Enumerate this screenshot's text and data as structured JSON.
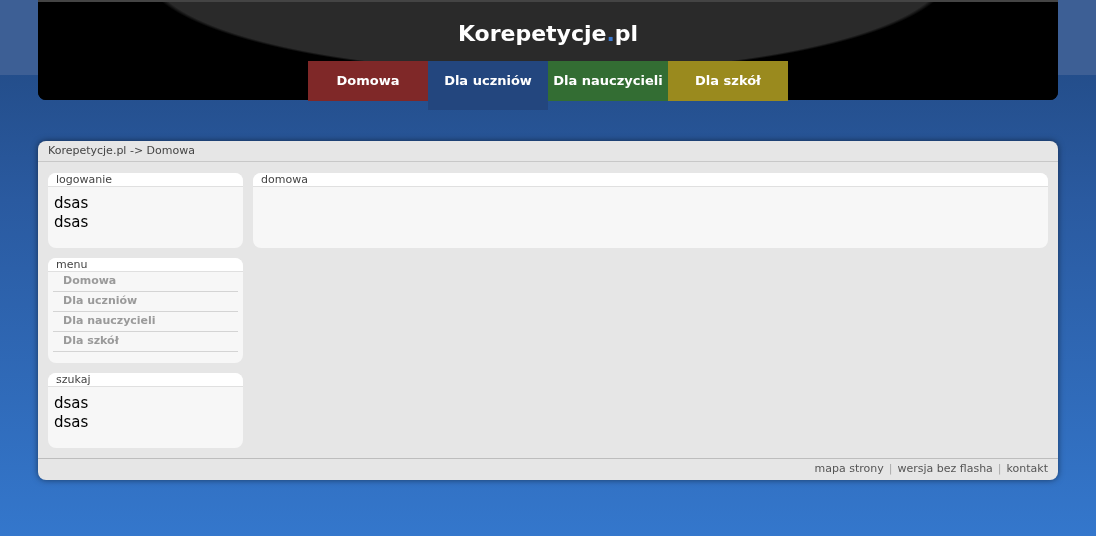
{
  "logo": {
    "name": "Korepetycje",
    "dot": ".",
    "tld": "pl"
  },
  "nav": [
    {
      "label": "Domowa",
      "color": "#7f2828",
      "selected": false
    },
    {
      "label": "Dla uczniów",
      "color": "#23467e",
      "selected": true
    },
    {
      "label": "Dla nauczycieli",
      "color": "#336d33",
      "selected": false
    },
    {
      "label": "Dla szkół",
      "color": "#9a8a1e",
      "selected": false
    }
  ],
  "breadcrumb": "Korepetycje.pl -> Domowa",
  "login_box": {
    "title": "logowanie",
    "lines": [
      "dsas",
      "dsas"
    ]
  },
  "menu_box": {
    "title": "menu",
    "items": [
      "Domowa",
      "Dla uczniów",
      "Dla nauczycieli",
      "Dla szkół"
    ]
  },
  "search_box": {
    "title": "szukaj",
    "lines": [
      "dsas",
      "dsas"
    ]
  },
  "content_box": {
    "title": "domowa"
  },
  "footer": {
    "separator": "|",
    "links": [
      "mapa strony",
      "wersja bez flasha",
      "kontakt"
    ]
  }
}
